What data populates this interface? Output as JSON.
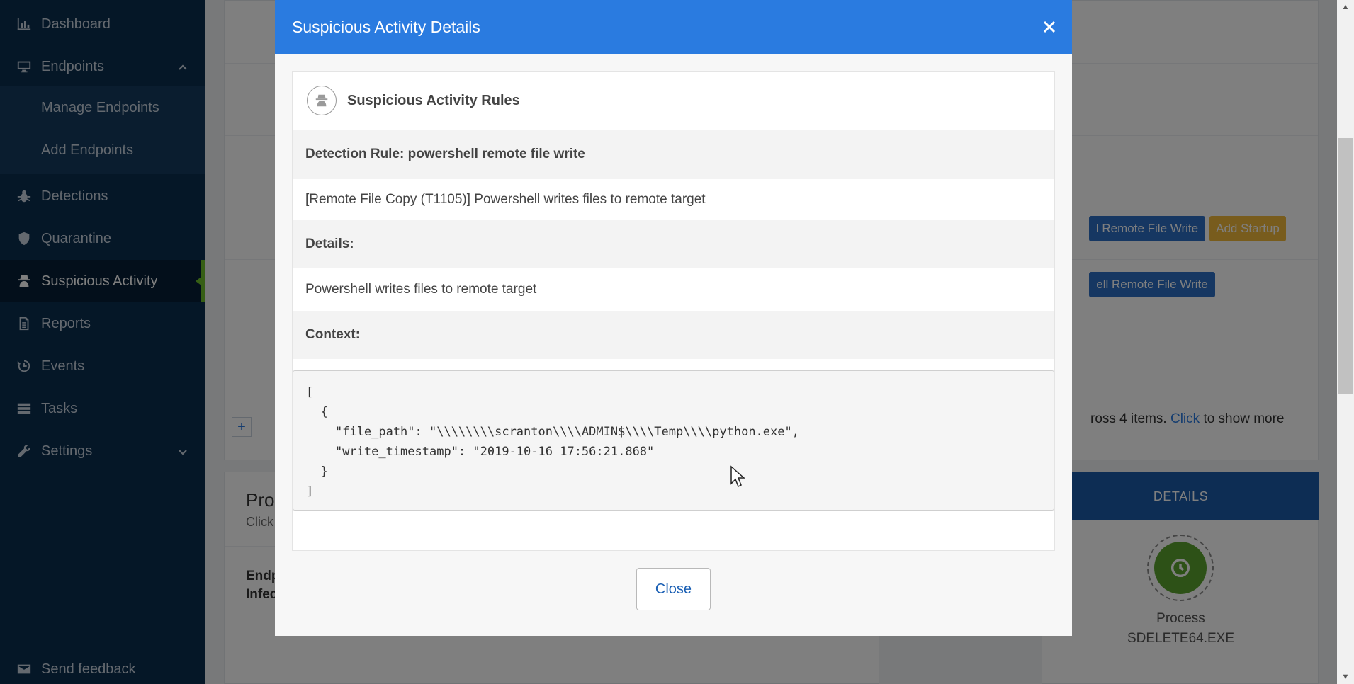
{
  "sidebar": {
    "items": [
      {
        "label": "Dashboard",
        "icon": "bar-chart-icon"
      },
      {
        "label": "Endpoints",
        "icon": "monitor-icon"
      },
      {
        "label": "Manage Endpoints"
      },
      {
        "label": "Add Endpoints"
      },
      {
        "label": "Detections",
        "icon": "bug-icon"
      },
      {
        "label": "Quarantine",
        "icon": "shield-icon"
      },
      {
        "label": "Suspicious Activity",
        "icon": "spy-icon"
      },
      {
        "label": "Reports",
        "icon": "document-icon"
      },
      {
        "label": "Events",
        "icon": "history-icon"
      },
      {
        "label": "Tasks",
        "icon": "tasks-icon"
      },
      {
        "label": "Settings",
        "icon": "wrench-icon"
      }
    ],
    "feedback": "Send feedback"
  },
  "background": {
    "tag_remote_write_1": "l Remote File Write",
    "tag_add_startup": "Add Startup",
    "tag_remote_write_2": "ell Remote File Write",
    "show_more_text": "ross 4 items.",
    "show_more_link": "Click",
    "show_more_suffix": "to show more",
    "section_title": "Pro",
    "section_sub": "Click",
    "endp_label": "Endp",
    "infec_label": "Infec",
    "details_tab": "DETAILS",
    "process_label": "Process",
    "process_name": "SDELETE64.EXE",
    "plus_btn": "+"
  },
  "modal": {
    "title": "Suspicious Activity Details",
    "panel_title": "Suspicious Activity Rules",
    "rule_label": "Detection Rule: powershell remote file write",
    "rule_desc": "[Remote File Copy (T1105)] Powershell writes files to remote target",
    "details_label": "Details:",
    "details_text": "Powershell writes files to remote target",
    "context_label": "Context:",
    "context_json": "[\n  {\n    \"file_path\": \"\\\\\\\\\\\\\\\\scranton\\\\\\\\ADMIN$\\\\\\\\Temp\\\\\\\\python.exe\",\n    \"write_timestamp\": \"2019-10-16 17:56:21.868\"\n  }\n]",
    "close_label": "Close"
  },
  "colors": {
    "sidebar": "#0b2e4f",
    "accent": "#2a7be0",
    "active_marker": "#6cbf2a"
  }
}
